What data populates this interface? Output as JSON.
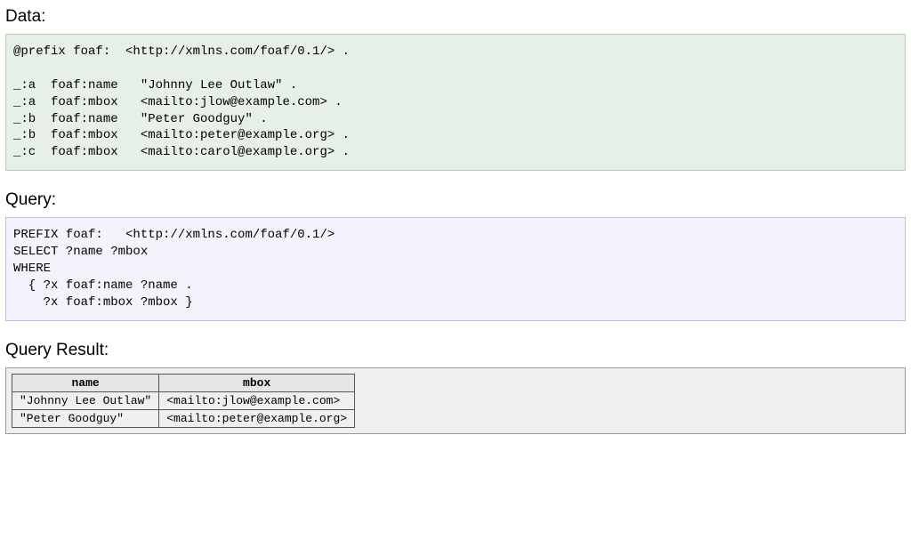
{
  "sections": {
    "data": {
      "label": "Data:",
      "code": "@prefix foaf:  <http://xmlns.com/foaf/0.1/> .\n\n_:a  foaf:name   \"Johnny Lee Outlaw\" .\n_:a  foaf:mbox   <mailto:jlow@example.com> .\n_:b  foaf:name   \"Peter Goodguy\" .\n_:b  foaf:mbox   <mailto:peter@example.org> .\n_:c  foaf:mbox   <mailto:carol@example.org> ."
    },
    "query": {
      "label": "Query:",
      "code": "PREFIX foaf:   <http://xmlns.com/foaf/0.1/>\nSELECT ?name ?mbox\nWHERE\n  { ?x foaf:name ?name .\n    ?x foaf:mbox ?mbox }"
    },
    "result": {
      "label": "Query Result:",
      "headers": [
        "name",
        "mbox"
      ],
      "rows": [
        [
          "\"Johnny Lee Outlaw\"",
          "<mailto:jlow@example.com>"
        ],
        [
          "\"Peter Goodguy\"",
          "<mailto:peter@example.org>"
        ]
      ]
    }
  }
}
